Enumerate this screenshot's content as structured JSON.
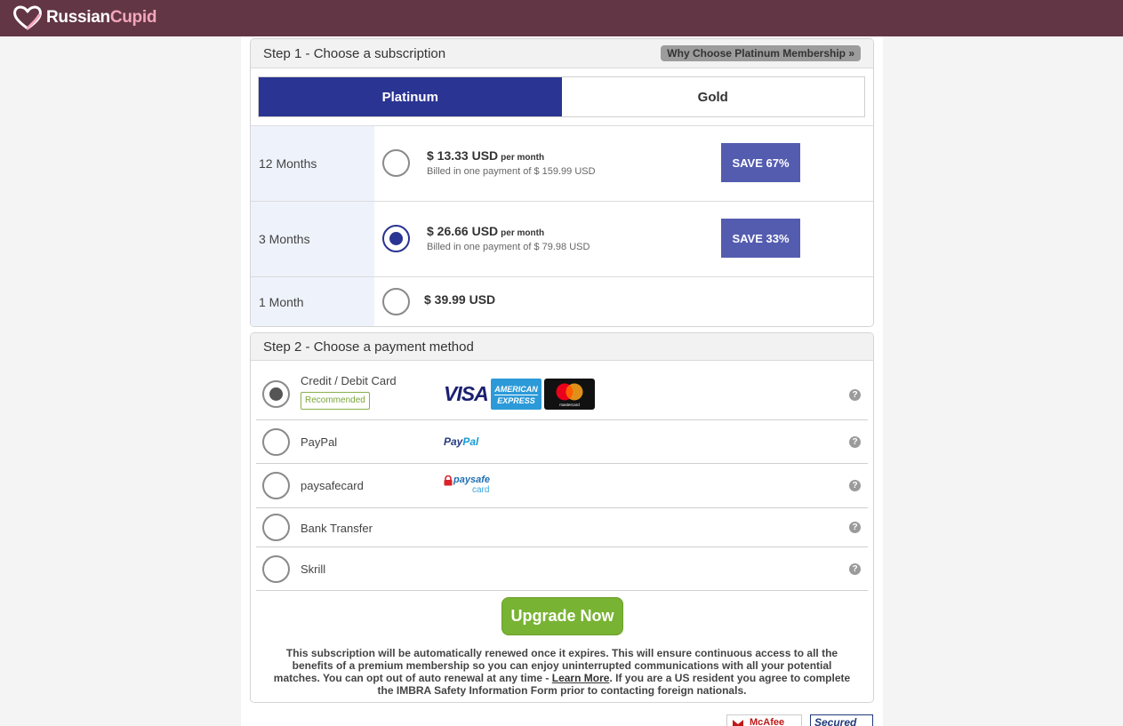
{
  "brand": {
    "name_part1": "Russian",
    "name_part2": "Cupid"
  },
  "step1": {
    "title": "Step 1 - Choose a subscription",
    "why_label": "Why Choose Platinum Membership »",
    "tabs": [
      {
        "label": "Platinum",
        "active": true
      },
      {
        "label": "Gold",
        "active": false
      }
    ],
    "plans": [
      {
        "term": "12 Months",
        "price": "$ 13.33 USD",
        "per": "per month",
        "billed": "Billed in one payment of $ 159.99 USD",
        "save": "SAVE 67%",
        "selected": false
      },
      {
        "term": "3 Months",
        "price": "$ 26.66 USD",
        "per": "per month",
        "billed": "Billed in one payment of $ 79.98 USD",
        "save": "SAVE 33%",
        "selected": true
      },
      {
        "term": "1 Month",
        "price": "$ 39.99 USD",
        "selected": false
      }
    ]
  },
  "step2": {
    "title": "Step 2 - Choose a payment method",
    "methods": [
      {
        "label": "Credit / Debit Card",
        "badge": "Recommended",
        "selected": true,
        "logos": [
          "VISA",
          "AMERICAN EXPRESS",
          "mastercard"
        ]
      },
      {
        "label": "PayPal",
        "logo_part1": "Pay",
        "logo_part2": "Pal",
        "selected": false
      },
      {
        "label": "paysafecard",
        "logo_part1": "paysafe",
        "logo_part2": "card",
        "selected": false
      },
      {
        "label": "Bank Transfer",
        "selected": false
      },
      {
        "label": "Skrill",
        "selected": false
      }
    ],
    "help_glyph": "?"
  },
  "upgrade_label": "Upgrade Now",
  "notice": {
    "text_before": "This subscription will be automatically renewed once it expires. This will ensure continuous access to all the benefits of a premium membership so you can enjoy uninterrupted communications with all your potential matches. You can opt out of auto renewal at any time - ",
    "link": "Learn More",
    "text_after": ". If you are a US resident you agree to complete the IMBRA Safety Information Form prior to contacting foreign nationals."
  },
  "footer_badges": [
    "McAfee",
    "Secured"
  ],
  "colors": {
    "header": "#623644",
    "primary": "#2a3493",
    "save": "#545cb0",
    "upgrade": "#78b333"
  },
  "icons": [
    "heart-logo-icon",
    "help-icon",
    "visa-logo-icon",
    "amex-logo-icon",
    "mastercard-logo-icon",
    "paypal-logo-icon",
    "paysafecard-logo-icon"
  ]
}
